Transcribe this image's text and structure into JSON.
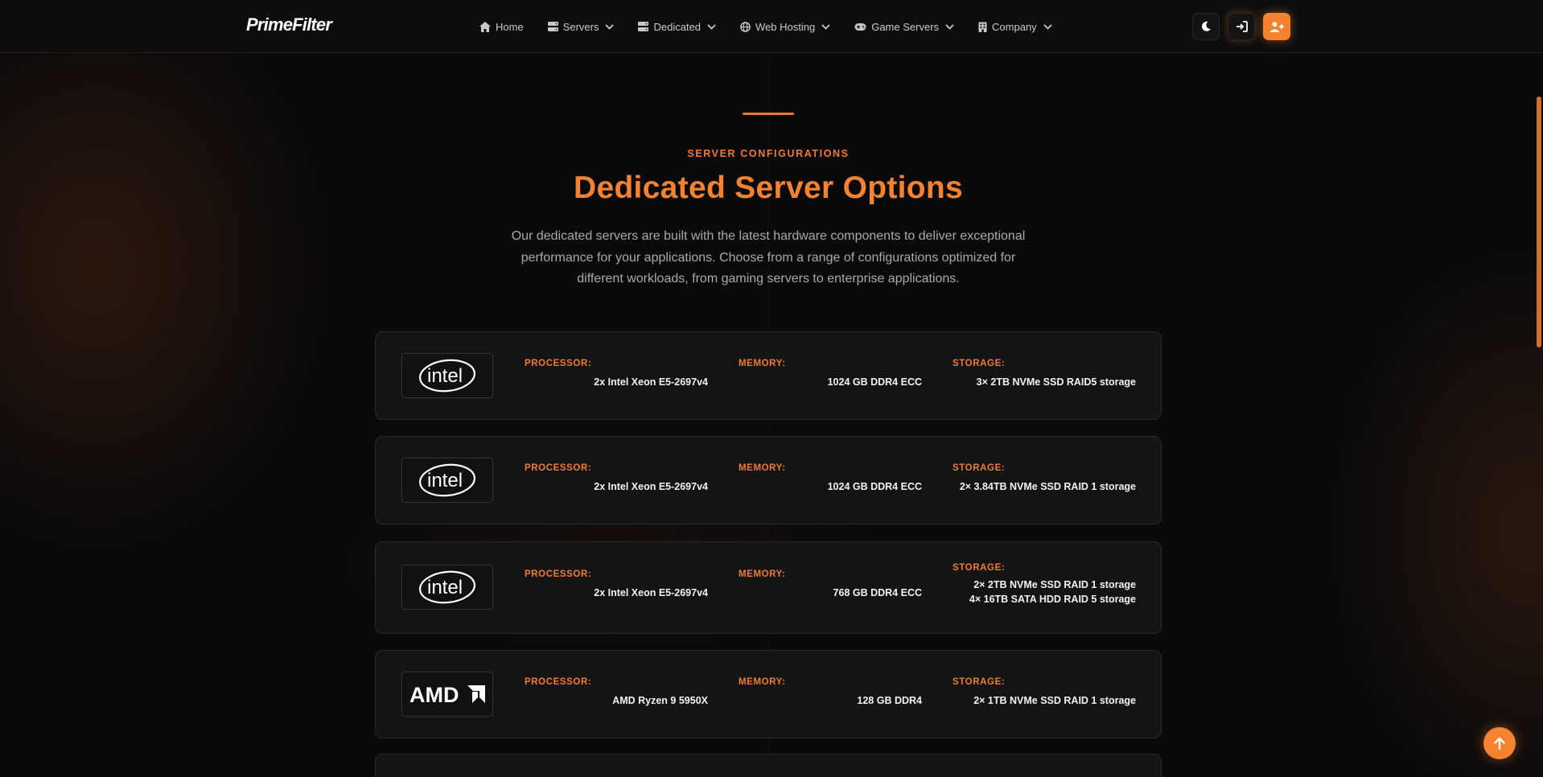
{
  "brand": {
    "name": "PrimeFilter"
  },
  "nav": {
    "items": [
      {
        "label": "Home",
        "icon": "home-icon",
        "dropdown": false
      },
      {
        "label": "Servers",
        "icon": "server-icon",
        "dropdown": true
      },
      {
        "label": "Dedicated",
        "icon": "server-icon",
        "dropdown": true
      },
      {
        "label": "Web Hosting",
        "icon": "globe-icon",
        "dropdown": true
      },
      {
        "label": "Game Servers",
        "icon": "gamepad-icon",
        "dropdown": true
      },
      {
        "label": "Company",
        "icon": "building-icon",
        "dropdown": true
      }
    ]
  },
  "header_buttons": [
    "moon-icon",
    "sign-in-icon",
    "user-plus-icon"
  ],
  "section": {
    "eyebrow": "SERVER CONFIGURATIONS",
    "title": "Dedicated Server Options",
    "description": "Our dedicated servers are built with the latest hardware components to deliver exceptional performance for your applications. Choose from a range of configurations optimized for different workloads, from gaming servers to enterprise applications."
  },
  "labels": {
    "processor": "PROCESSOR:",
    "memory": "MEMORY:",
    "storage": "STORAGE:"
  },
  "servers": [
    {
      "brand": "intel",
      "processor": "2x Intel Xeon E5-2697v4",
      "memory": "1024 GB DDR4 ECC",
      "storage": [
        "3× 2TB NVMe SSD RAID5 storage"
      ]
    },
    {
      "brand": "intel",
      "processor": "2x Intel Xeon E5-2697v4",
      "memory": "1024 GB DDR4 ECC",
      "storage": [
        "2× 3.84TB NVMe SSD RAID 1 storage"
      ]
    },
    {
      "brand": "intel",
      "processor": "2x Intel Xeon E5-2697v4",
      "memory": "768 GB DDR4 ECC",
      "storage": [
        "2× 2TB NVMe SSD RAID 1 storage",
        "4× 16TB SATA HDD RAID 5 storage"
      ]
    },
    {
      "brand": "AMD",
      "processor": "AMD Ryzen 9 5950X",
      "memory": "128 GB DDR4",
      "storage": [
        "2× 1TB NVMe SSD RAID 1 storage"
      ]
    }
  ],
  "colors": {
    "accent": "#f58231",
    "background": "#0a0a0b",
    "card": "#141415"
  }
}
